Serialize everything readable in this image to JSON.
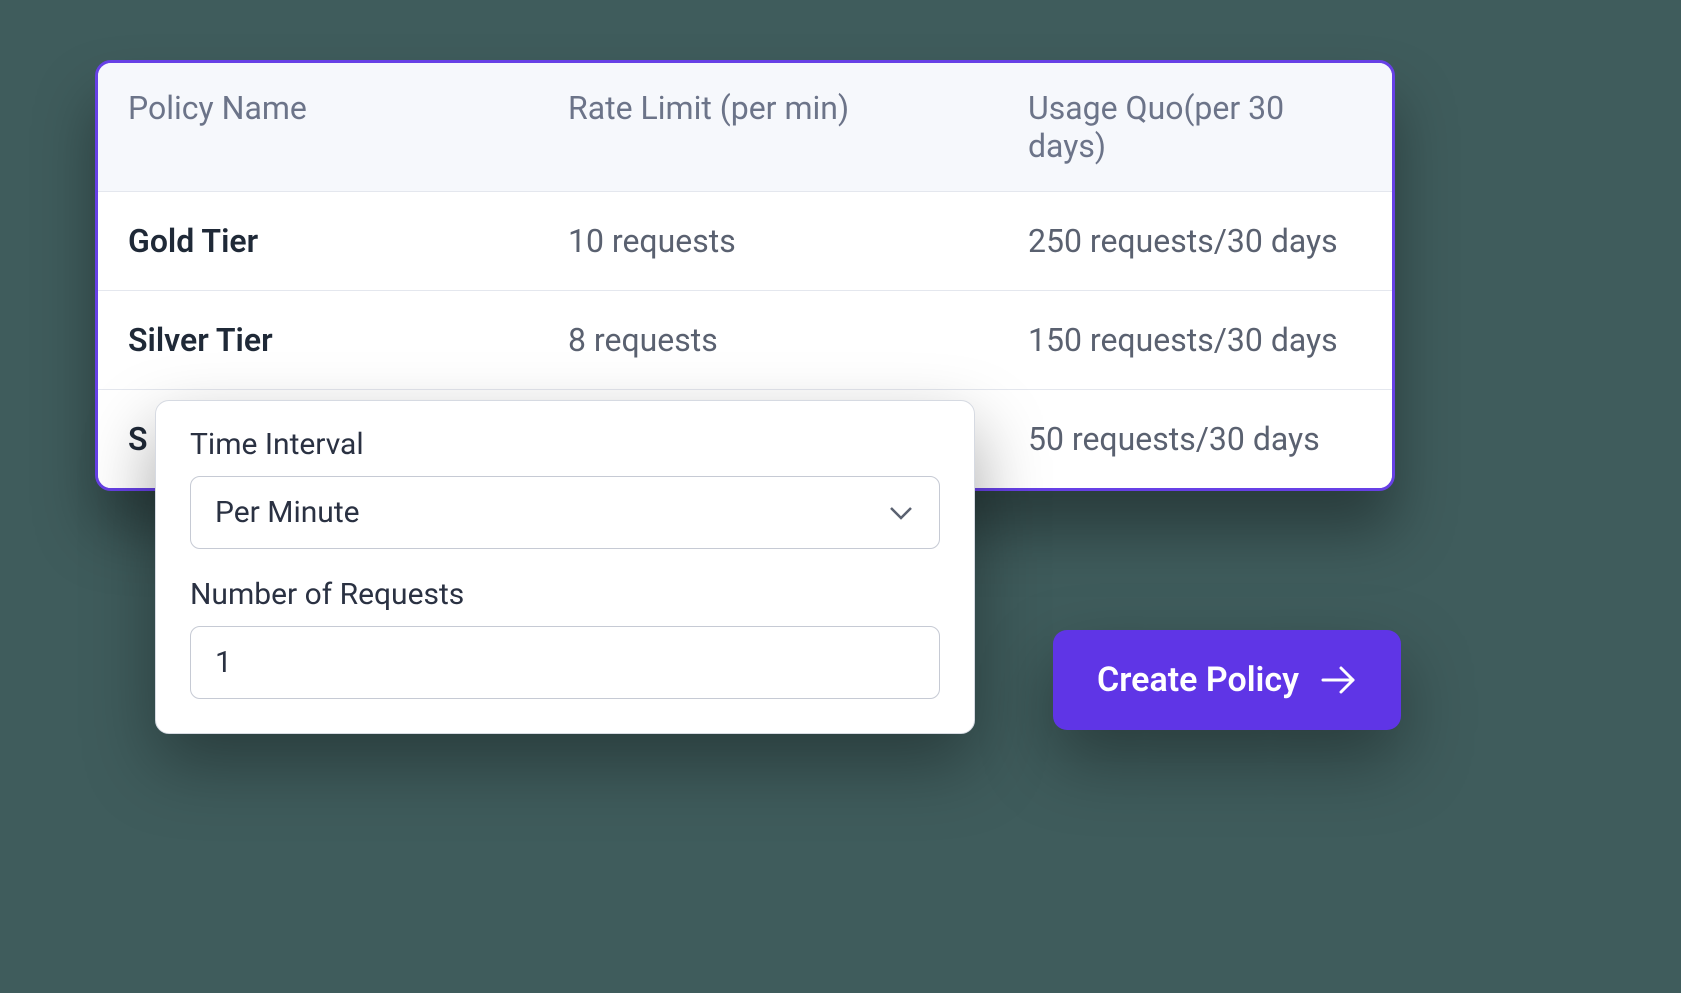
{
  "table": {
    "headers": {
      "name": "Policy Name",
      "rate": "Rate Limit (per min)",
      "quota": "Usage Quo(per 30 days)"
    },
    "rows": [
      {
        "name": "Gold Tier",
        "rate": "10 requests",
        "quota": "250 requests/30 days"
      },
      {
        "name": "Silver Tier",
        "rate": "8 requests",
        "quota": "150 requests/30 days"
      },
      {
        "name": "S",
        "rate": "",
        "quota": "50 requests/30 days"
      }
    ]
  },
  "popup": {
    "time_interval_label": "Time Interval",
    "time_interval_value": "Per Minute",
    "num_requests_label": "Number of Requests",
    "num_requests_value": "1"
  },
  "create_button_label": "Create Policy"
}
